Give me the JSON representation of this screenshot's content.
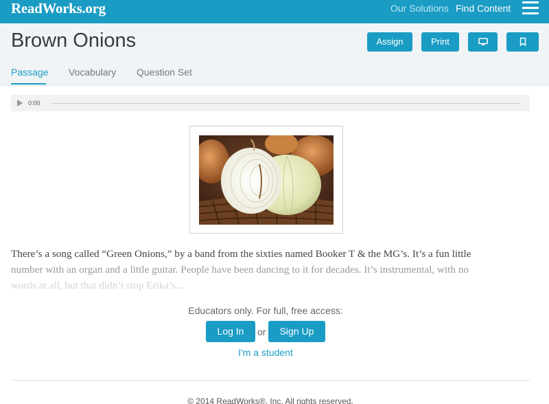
{
  "header": {
    "logo_text": "ReadWorks.org",
    "nav": [
      "Our Solutions",
      "Find Content"
    ],
    "menu_icon": "hamburger-menu-icon"
  },
  "article": {
    "title": "Brown Onions",
    "actions": {
      "assign": "Assign",
      "print": "Print",
      "present_icon": "monitor-icon",
      "bookmark_icon": "bookmark-icon"
    },
    "tabs": [
      "Passage",
      "Vocabulary",
      "Question Set"
    ],
    "active_tab": "Passage"
  },
  "audio": {
    "time": "0:00",
    "play_icon": "play-icon"
  },
  "image": {
    "subject": "onion-photo"
  },
  "passage": {
    "lines": [
      "There’s a song called “Green Onions,” by a band from the sixties named Booker T & the MG’s. It’s a fun little",
      "number with an organ and a little guitar. People have been dancing to it for decades. It’s instrumental, with no",
      "words at all, but that didn’t stop Erika’s..."
    ]
  },
  "access": {
    "prompt": "Educators only. For full, free access:",
    "login": "Log In",
    "or": "or",
    "signup": "Sign Up",
    "student": "I'm a student"
  },
  "footer": {
    "copyright": "© 2014 ReadWorks®, Inc. All rights reserved."
  },
  "colors": {
    "brand": "#1a9cc4",
    "title_bar": "#f0f4f6"
  }
}
